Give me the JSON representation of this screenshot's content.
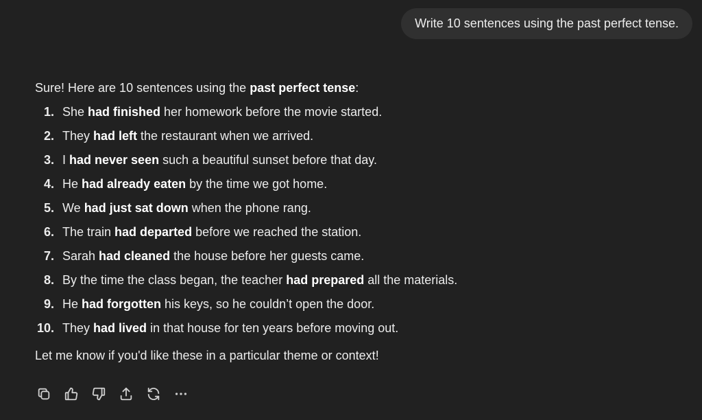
{
  "user_message": "Write 10 sentences using the past perfect tense.",
  "assistant": {
    "intro": {
      "before": "Sure! Here are 10 sentences using the ",
      "bold": "past perfect tense",
      "after": ":"
    },
    "items": [
      {
        "num": "1.",
        "pre": "She ",
        "bold": "had finished",
        "post": " her homework before the movie started."
      },
      {
        "num": "2.",
        "pre": "They ",
        "bold": "had left",
        "post": " the restaurant when we arrived."
      },
      {
        "num": "3.",
        "pre": "I ",
        "bold": "had never seen",
        "post": " such a beautiful sunset before that day."
      },
      {
        "num": "4.",
        "pre": "He ",
        "bold": "had already eaten",
        "post": " by the time we got home."
      },
      {
        "num": "5.",
        "pre": "We ",
        "bold": "had just sat down",
        "post": " when the phone rang."
      },
      {
        "num": "6.",
        "pre": "The train ",
        "bold": "had departed",
        "post": " before we reached the station."
      },
      {
        "num": "7.",
        "pre": "Sarah ",
        "bold": "had cleaned",
        "post": " the house before her guests came."
      },
      {
        "num": "8.",
        "pre": "By the time the class began, the teacher ",
        "bold": "had prepared",
        "post": " all the materials."
      },
      {
        "num": "9.",
        "pre": "He ",
        "bold": "had forgotten",
        "post": " his keys, so he couldn’t open the door."
      },
      {
        "num": "10.",
        "pre": "They ",
        "bold": "had lived",
        "post": " in that house for ten years before moving out."
      }
    ],
    "outro": "Let me know if you'd like these in a particular theme or context!"
  },
  "actions": [
    {
      "name": "copy-icon"
    },
    {
      "name": "thumbs-up-icon"
    },
    {
      "name": "thumbs-down-icon"
    },
    {
      "name": "share-icon"
    },
    {
      "name": "regenerate-icon"
    },
    {
      "name": "more-options-icon"
    }
  ],
  "colors": {
    "background": "#212121",
    "bubble": "#303030",
    "text": "#ececec"
  }
}
